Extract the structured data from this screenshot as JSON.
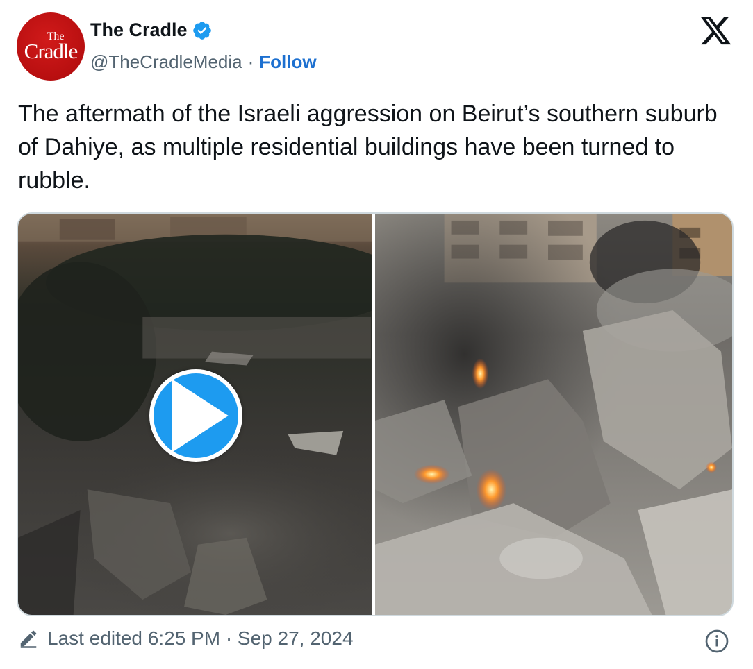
{
  "author": {
    "avatar": {
      "line1": "The",
      "line2": "Cradle"
    },
    "display_name": "The Cradle",
    "verified": true,
    "handle": "@TheCradleMedia",
    "separator": "·",
    "follow_label": "Follow"
  },
  "platform_icon": "x-logo-icon",
  "tweet": {
    "text": "The aftermath of the Israeli aggression on Beirut’s southern suburb of Dahiye, as multiple residential buildings have been turned to rubble."
  },
  "media": {
    "items": [
      {
        "type": "video",
        "icon": "play-icon"
      },
      {
        "type": "image"
      }
    ]
  },
  "footer": {
    "edited_label": "Last edited 6:25 PM · Sep 27, 2024",
    "icons": [
      "pencil-icon",
      "info-icon"
    ]
  },
  "colors": {
    "accent": "#1d9bf0",
    "follow": "#1d70d0",
    "avatar": "#c0141a",
    "muted": "#536471",
    "border": "#cfd9de"
  }
}
